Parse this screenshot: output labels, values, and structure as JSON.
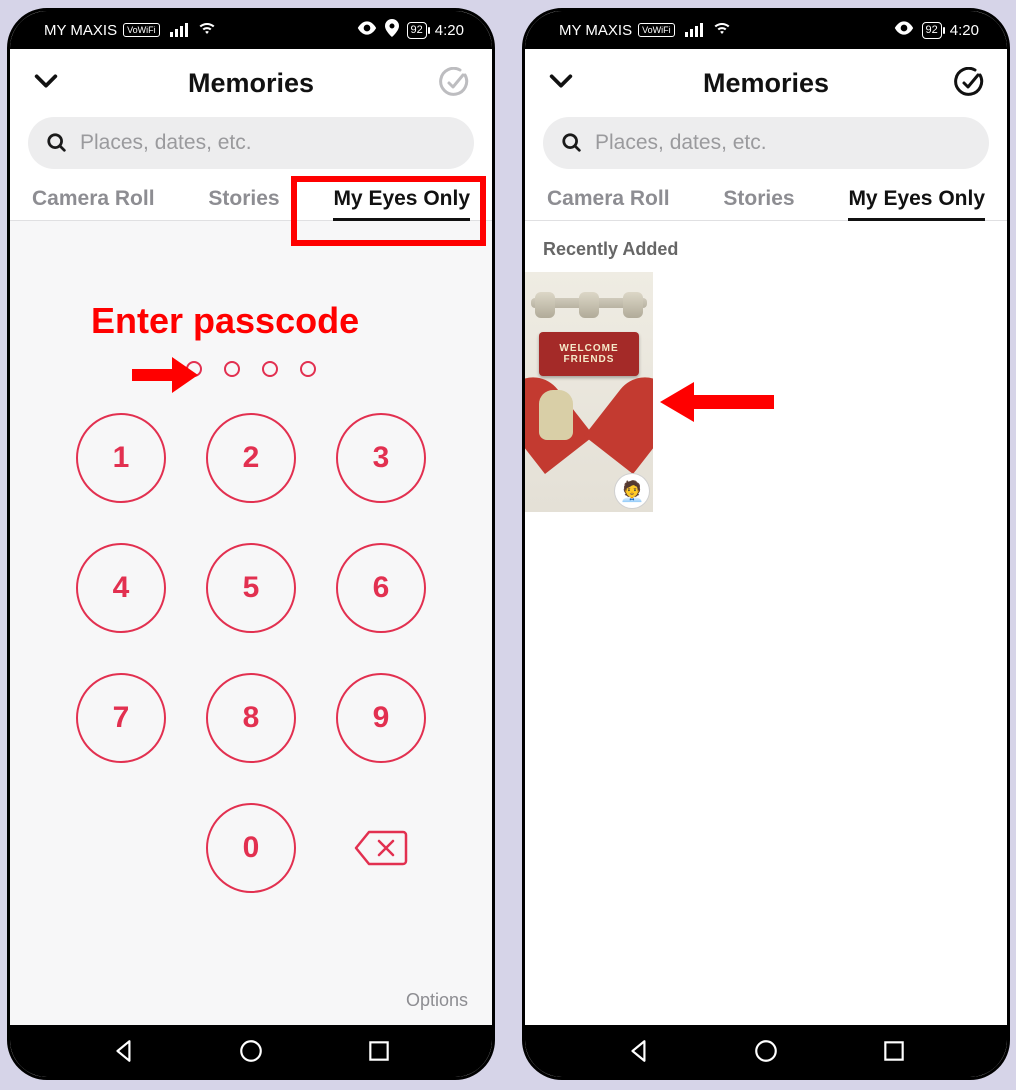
{
  "status": {
    "carrier": "MY MAXIS",
    "vowifi": "VoWiFi",
    "battery": "92",
    "time": "4:20"
  },
  "header": {
    "title": "Memories"
  },
  "search": {
    "placeholder": "Places, dates, etc."
  },
  "tabs": {
    "camera_roll": "Camera Roll",
    "stories": "Stories",
    "my_eyes_only": "My Eyes Only"
  },
  "passcode": {
    "keys": [
      "1",
      "2",
      "3",
      "4",
      "5",
      "6",
      "7",
      "8",
      "9",
      "",
      "0",
      ""
    ],
    "options_label": "Options"
  },
  "right_panel": {
    "section_title": "Recently Added",
    "sign_line1": "WELCOME",
    "sign_line2": "FRIENDS"
  },
  "annotations": {
    "enter_passcode": "Enter passcode"
  }
}
